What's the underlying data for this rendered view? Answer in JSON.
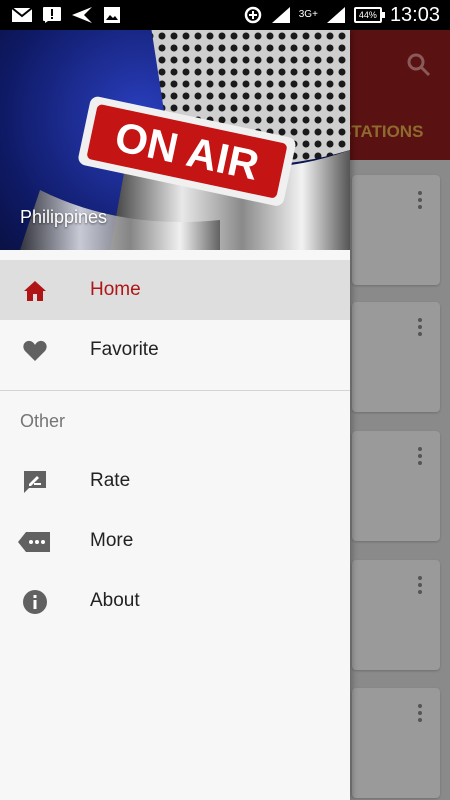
{
  "status_bar": {
    "network_type": "3G+",
    "battery": "44%",
    "time": "13:03"
  },
  "background_app": {
    "tab_label": "STATIONS",
    "accent_color": "#5a1111"
  },
  "drawer": {
    "header": {
      "sign_text": "ON AIR",
      "country": "Philippines"
    },
    "items": [
      {
        "label": "Home",
        "icon": "home-icon",
        "active": true
      },
      {
        "label": "Favorite",
        "icon": "heart-icon",
        "active": false
      }
    ],
    "section_title": "Other",
    "other_items": [
      {
        "label": "Rate",
        "icon": "rate-icon"
      },
      {
        "label": "More",
        "icon": "more-icon"
      },
      {
        "label": "About",
        "icon": "info-icon"
      }
    ],
    "active_color": "#b01515"
  }
}
